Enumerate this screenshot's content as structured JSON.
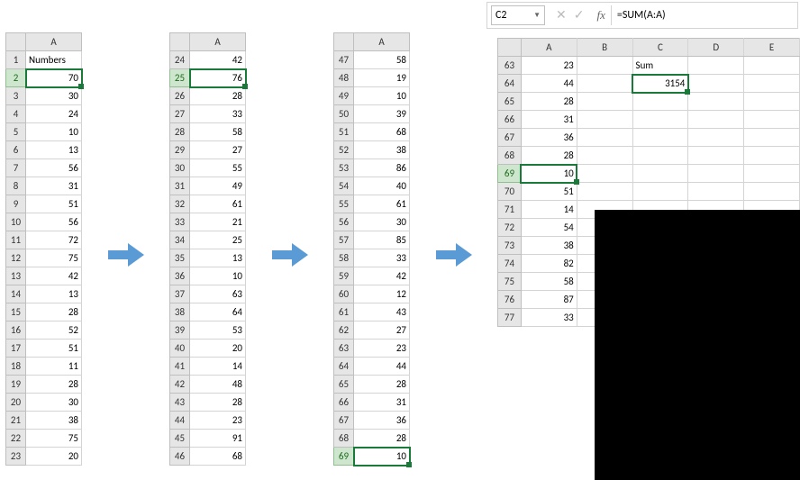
{
  "formula_bar": {
    "cell_ref": "C2",
    "formula": "=SUM(A:A)",
    "fx_label": "fx"
  },
  "panel1": {
    "col": "A",
    "header": "Numbers",
    "rows": [
      {
        "r": 1
      },
      {
        "r": 2,
        "v": 70
      },
      {
        "r": 3,
        "v": 30
      },
      {
        "r": 4,
        "v": 24
      },
      {
        "r": 5,
        "v": 10
      },
      {
        "r": 6,
        "v": 13
      },
      {
        "r": 7,
        "v": 56
      },
      {
        "r": 8,
        "v": 31
      },
      {
        "r": 9,
        "v": 51
      },
      {
        "r": 10,
        "v": 56
      },
      {
        "r": 11,
        "v": 72
      },
      {
        "r": 12,
        "v": 75
      },
      {
        "r": 13,
        "v": 42
      },
      {
        "r": 14,
        "v": 13
      },
      {
        "r": 15,
        "v": 28
      },
      {
        "r": 16,
        "v": 52
      },
      {
        "r": 17,
        "v": 51
      },
      {
        "r": 18,
        "v": 11
      },
      {
        "r": 19,
        "v": 28
      },
      {
        "r": 20,
        "v": 30
      },
      {
        "r": 21,
        "v": 38
      },
      {
        "r": 22,
        "v": 75
      },
      {
        "r": 23,
        "v": 20
      }
    ],
    "selected_row": 2
  },
  "panel2": {
    "col": "A",
    "rows": [
      {
        "r": 24,
        "v": 42
      },
      {
        "r": 25,
        "v": 76
      },
      {
        "r": 26,
        "v": 28
      },
      {
        "r": 27,
        "v": 33
      },
      {
        "r": 28,
        "v": 58
      },
      {
        "r": 29,
        "v": 27
      },
      {
        "r": 30,
        "v": 55
      },
      {
        "r": 31,
        "v": 49
      },
      {
        "r": 32,
        "v": 61
      },
      {
        "r": 33,
        "v": 21
      },
      {
        "r": 34,
        "v": 25
      },
      {
        "r": 35,
        "v": 13
      },
      {
        "r": 36,
        "v": 10
      },
      {
        "r": 37,
        "v": 63
      },
      {
        "r": 38,
        "v": 64
      },
      {
        "r": 39,
        "v": 53
      },
      {
        "r": 40,
        "v": 20
      },
      {
        "r": 41,
        "v": 14
      },
      {
        "r": 42,
        "v": 48
      },
      {
        "r": 43,
        "v": 28
      },
      {
        "r": 44,
        "v": 23
      },
      {
        "r": 45,
        "v": 91
      },
      {
        "r": 46,
        "v": 68
      }
    ],
    "selected_row": 25
  },
  "panel3": {
    "col": "A",
    "rows": [
      {
        "r": 47,
        "v": 58
      },
      {
        "r": 48,
        "v": 19
      },
      {
        "r": 49,
        "v": 10
      },
      {
        "r": 50,
        "v": 39
      },
      {
        "r": 51,
        "v": 68
      },
      {
        "r": 52,
        "v": 38
      },
      {
        "r": 53,
        "v": 86
      },
      {
        "r": 54,
        "v": 40
      },
      {
        "r": 55,
        "v": 61
      },
      {
        "r": 56,
        "v": 30
      },
      {
        "r": 57,
        "v": 85
      },
      {
        "r": 58,
        "v": 33
      },
      {
        "r": 59,
        "v": 42
      },
      {
        "r": 60,
        "v": 12
      },
      {
        "r": 61,
        "v": 43
      },
      {
        "r": 62,
        "v": 27
      },
      {
        "r": 63,
        "v": 23
      },
      {
        "r": 64,
        "v": 44
      },
      {
        "r": 65,
        "v": 28
      },
      {
        "r": 66,
        "v": 31
      },
      {
        "r": 67,
        "v": 36
      },
      {
        "r": 68,
        "v": 28
      },
      {
        "r": 69,
        "v": 10
      }
    ],
    "selected_row": 69
  },
  "panel4": {
    "cols": [
      "A",
      "B",
      "C",
      "D",
      "E"
    ],
    "sum_label": "Sum",
    "sum_value": 3154,
    "rows": [
      {
        "r": 63,
        "v": 23
      },
      {
        "r": 64,
        "v": 44
      },
      {
        "r": 65,
        "v": 28
      },
      {
        "r": 66,
        "v": 31
      },
      {
        "r": 67,
        "v": 36
      },
      {
        "r": 68,
        "v": 28
      },
      {
        "r": 69,
        "v": 10
      },
      {
        "r": 70,
        "v": 51
      },
      {
        "r": 71,
        "v": 14
      },
      {
        "r": 72,
        "v": 54
      },
      {
        "r": 73,
        "v": 38
      },
      {
        "r": 74,
        "v": 82
      },
      {
        "r": 75,
        "v": 58
      },
      {
        "r": 76,
        "v": 87
      },
      {
        "r": 77,
        "v": 33
      }
    ],
    "selected_row": 69,
    "c2_selected": true
  },
  "chart_data": {
    "type": "table",
    "title": "Numbers column with running sum",
    "sum_formula": "=SUM(A:A)",
    "sum_result": 3154,
    "values": [
      70,
      30,
      24,
      10,
      13,
      56,
      31,
      51,
      56,
      72,
      75,
      42,
      13,
      28,
      52,
      51,
      11,
      28,
      30,
      38,
      75,
      20,
      42,
      76,
      28,
      33,
      58,
      27,
      55,
      49,
      61,
      21,
      25,
      13,
      10,
      63,
      64,
      53,
      20,
      14,
      48,
      28,
      23,
      91,
      68,
      58,
      19,
      10,
      39,
      68,
      38,
      86,
      40,
      61,
      30,
      85,
      33,
      42,
      12,
      43,
      27,
      23,
      44,
      28,
      31,
      36,
      28,
      10,
      51,
      14,
      54,
      38,
      82,
      58,
      87,
      33
    ]
  }
}
